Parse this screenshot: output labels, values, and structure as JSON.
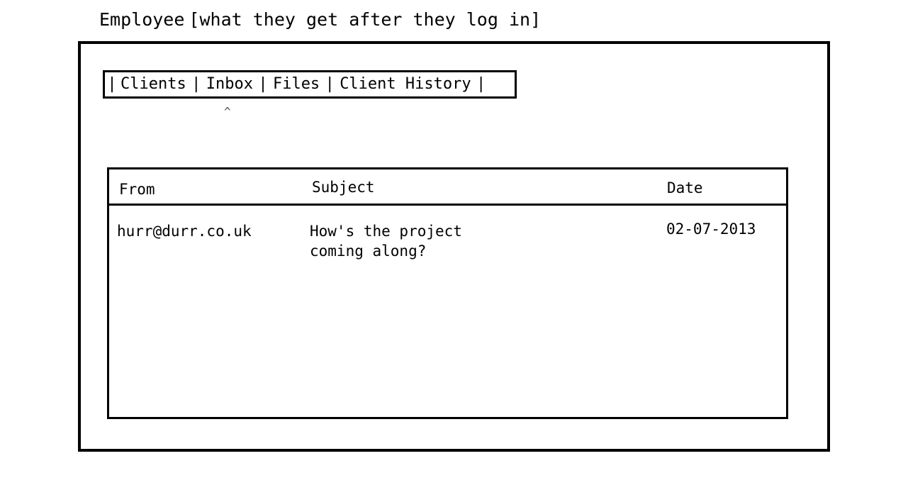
{
  "page": {
    "title": "Employee",
    "note": "[what they get after they log in]"
  },
  "nav": {
    "separator": "|",
    "items": [
      {
        "label": "Clients"
      },
      {
        "label": "Inbox"
      },
      {
        "label": "Files"
      },
      {
        "label": "Client History"
      }
    ],
    "active_index": 1,
    "active_marker": "^"
  },
  "inbox": {
    "columns": {
      "from": "From",
      "subject": "Subject",
      "date": "Date"
    },
    "messages": [
      {
        "from": "hurr@durr.co.uk",
        "subject": "How's the project coming along?",
        "date": "02-07-2013"
      }
    ]
  }
}
